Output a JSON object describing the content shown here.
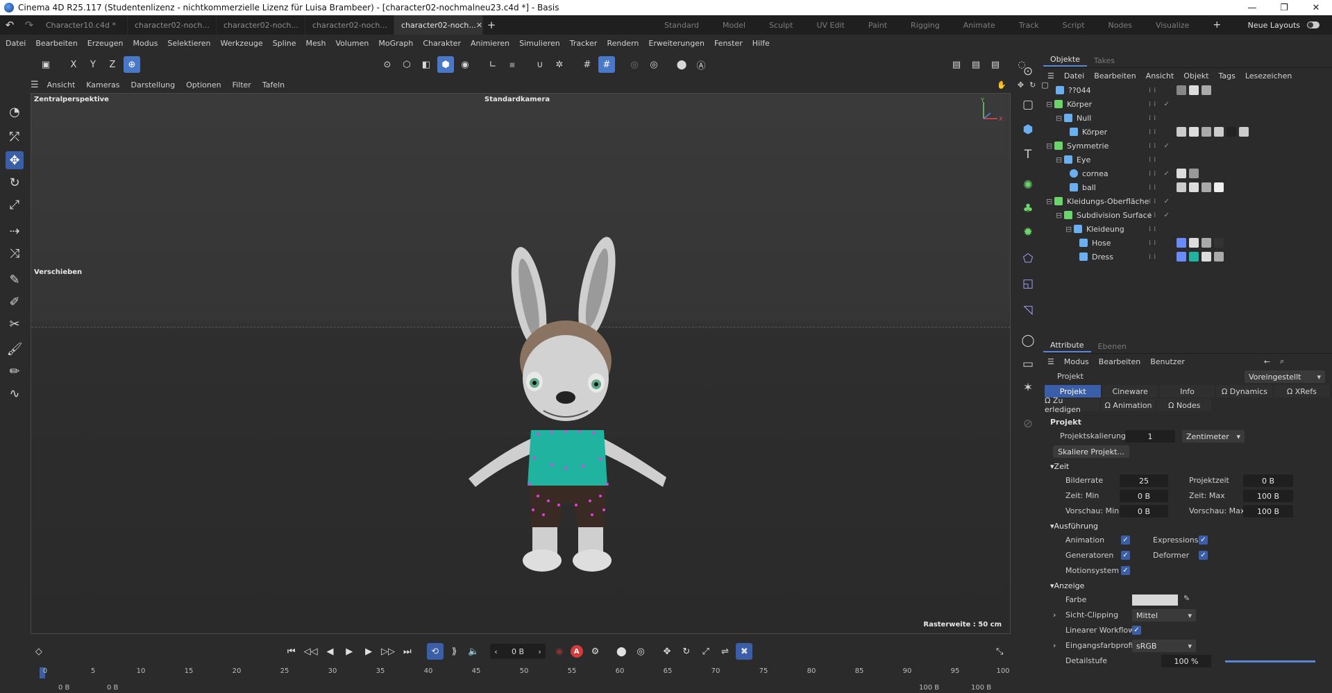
{
  "window": {
    "title": "Cinema 4D R25.117 (Studentenlizenz - nichtkommerzielle Lizenz für Luisa Brambeer) - [character02-nochmalneu23.c4d *] - Basis"
  },
  "doc_tabs": [
    {
      "label": "Character10.c4d *"
    },
    {
      "label": "character02-noch..."
    },
    {
      "label": "character02-noch..."
    },
    {
      "label": "character02-noch..."
    },
    {
      "label": "character02-noch..."
    },
    {
      "label": "character02-noch..."
    }
  ],
  "layouts": [
    "Standard",
    "Model",
    "Sculpt",
    "UV Edit",
    "Paint",
    "Rigging",
    "Animate",
    "Track",
    "Script",
    "Nodes",
    "Visualize"
  ],
  "neue_layouts": "Neue Layouts",
  "menu": [
    "Datei",
    "Bearbeiten",
    "Erzeugen",
    "Modus",
    "Selektieren",
    "Werkzeuge",
    "Spline",
    "Mesh",
    "Volumen",
    "MoGraph",
    "Charakter",
    "Animieren",
    "Simulieren",
    "Tracker",
    "Rendern",
    "Erweiterungen",
    "Fenster",
    "Hilfe"
  ],
  "toolbar": {
    "x": "X",
    "y": "Y",
    "z": "Z"
  },
  "viewport": {
    "menu": [
      "Ansicht",
      "Kameras",
      "Darstellung",
      "Optionen",
      "Filter",
      "Tafeln"
    ],
    "perspective": "Zentralperspektive",
    "camera": "Standardkamera",
    "tool": "Verschieben",
    "grid": "Rasterweite : 50 cm"
  },
  "timeline": {
    "current_frame": "0 B",
    "record": "A",
    "ticks": [
      "0",
      "5",
      "10",
      "15",
      "20",
      "25",
      "30",
      "35",
      "40",
      "45",
      "50",
      "55",
      "60",
      "65",
      "70",
      "75",
      "80",
      "85",
      "90",
      "95",
      "100"
    ],
    "min": "0 B",
    "min2": "0 B",
    "max": "100 B",
    "max2": "100 B"
  },
  "objects": {
    "tabs": [
      "Objekte",
      "Takes"
    ],
    "menu": [
      "Datei",
      "Bearbeiten",
      "Ansicht",
      "Objekt",
      "Tags",
      "Lesezeichen"
    ],
    "items": [
      {
        "name": "??044",
        "indent": 0
      },
      {
        "name": "Körper",
        "indent": 0
      },
      {
        "name": "Null",
        "indent": 1
      },
      {
        "name": "Körper",
        "indent": 2
      },
      {
        "name": "Symmetrie",
        "indent": 0
      },
      {
        "name": "Eye",
        "indent": 1
      },
      {
        "name": "cornea",
        "indent": 2
      },
      {
        "name": "ball",
        "indent": 2
      },
      {
        "name": "Kleidungs-Oberfläche",
        "indent": 0
      },
      {
        "name": "Subdivision Surface",
        "indent": 1
      },
      {
        "name": "Kleideung",
        "indent": 2
      },
      {
        "name": "Hose",
        "indent": 3
      },
      {
        "name": "Dress",
        "indent": 3
      }
    ]
  },
  "attributes": {
    "tabs": [
      "Attribute",
      "Ebenen"
    ],
    "menu": [
      "Modus",
      "Bearbeiten",
      "Benutzer"
    ],
    "object": "Projekt",
    "preset": "Voreingestellt",
    "pills1": [
      "Projekt",
      "Cineware",
      "Info",
      "Ω Dynamics",
      "Ω XRefs"
    ],
    "pills2": [
      "Ω Zu erledigen",
      "Ω Animation",
      "Ω Nodes"
    ],
    "section_title": "Projekt",
    "projektskalierung_label": "Projektskalierung",
    "projektskalierung": "1",
    "unit": "Zentimeter",
    "skaliere": "Skaliere Projekt...",
    "zeit": "Zeit",
    "bilderrate_label": "Bilderrate",
    "bilderrate": "25",
    "projektzeit_label": "Projektzeit",
    "projektzeit": "0 B",
    "zeitmin_label": "Zeit: Min",
    "zeitmin": "0 B",
    "zeitmax_label": "Zeit: Max",
    "zeitmax": "100 B",
    "vmin_label": "Vorschau: Min",
    "vmin": "0 B",
    "vmax_label": "Vorschau: Max",
    "vmax": "100 B",
    "ausfuehrung": "Ausführung",
    "animation": "Animation",
    "expressions": "Expressions",
    "generatoren": "Generatoren",
    "deformer": "Deformer",
    "motionsystem": "Motionsystem",
    "anzeige": "Anzeige",
    "farbe": "Farbe",
    "sicht": "Sicht-Clipping",
    "sicht_val": "Mittel",
    "linear": "Linearer Workflow",
    "eingang": "Eingangsfarbprofil",
    "eingang_val": "sRGB",
    "detail": "Detailstufe",
    "detail_val": "100 %"
  }
}
